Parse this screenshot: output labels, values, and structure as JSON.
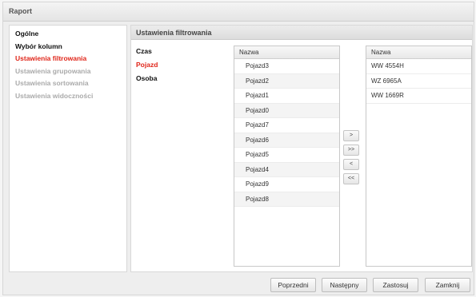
{
  "window": {
    "title": "Raport"
  },
  "nav": {
    "items": [
      {
        "label": "Ogólne",
        "state": "active"
      },
      {
        "label": "Wybór kolumn",
        "state": "active"
      },
      {
        "label": "Ustawienia filtrowania",
        "state": "current"
      },
      {
        "label": "Ustawienia grupowania",
        "state": "disabled"
      },
      {
        "label": "Ustawienia sortowania",
        "state": "disabled"
      },
      {
        "label": "Ustawienia widoczności",
        "state": "disabled"
      }
    ]
  },
  "content": {
    "header": "Ustawienia filtrowania",
    "categories": [
      {
        "label": "Czas",
        "selected": false
      },
      {
        "label": "Pojazd",
        "selected": true
      },
      {
        "label": "Osoba",
        "selected": false
      }
    ],
    "available": {
      "column_header": "Nazwa",
      "rows": [
        "Pojazd3",
        "Pojazd2",
        "Pojazd1",
        "Pojazd0",
        "Pojazd7",
        "Pojazd6",
        "Pojazd5",
        "Pojazd4",
        "Pojazd9",
        "Pojazd8"
      ]
    },
    "selected": {
      "column_header": "Nazwa",
      "rows": [
        "WW 4554H",
        "WZ 6965A",
        "WW 1669R"
      ]
    },
    "movers": {
      "move_right": ">",
      "move_all_right": ">>",
      "move_left": "<",
      "move_all_left": "<<"
    }
  },
  "footer": {
    "previous": "Poprzedni",
    "next": "Następny",
    "apply": "Zastosuj",
    "close": "Zamknij"
  },
  "colors": {
    "highlight": "#e0261a",
    "disabled": "#aaaaaa"
  }
}
